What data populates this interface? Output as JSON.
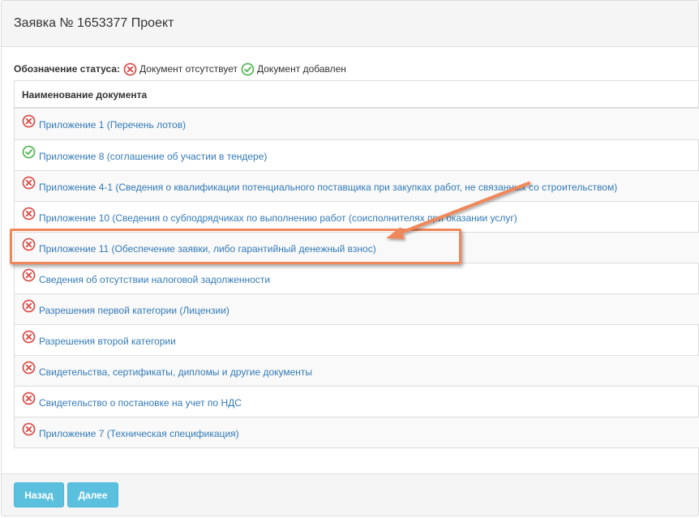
{
  "header": {
    "title": "Заявка № 1653377 Проект"
  },
  "legend": {
    "label": "Обозначение статуса:",
    "missing_text": "Документ отсутствует",
    "added_text": "Документ добавлен"
  },
  "table": {
    "header": "Наименование документа",
    "rows": [
      {
        "label": "Приложение 1 (Перечень лотов)",
        "status": "missing"
      },
      {
        "label": "Приложение 8 (соглашение об участии в тендере)",
        "status": "added"
      },
      {
        "label": "Приложение 4-1 (Сведения о квалификации потенциального поставщика при закупках работ, не связанных со строительством)",
        "status": "missing"
      },
      {
        "label": "Приложение 10 (Сведения о субподрядчиках по выполнению работ (соисполнителях при оказании услуг)",
        "status": "missing"
      },
      {
        "label": "Приложение 11 (Обеспечение заявки, либо гарантийный денежный взнос)",
        "status": "missing"
      },
      {
        "label": "Сведения об отсутствии налоговой задолженности",
        "status": "missing"
      },
      {
        "label": "Разрешения первой категории (Лицензии)",
        "status": "missing"
      },
      {
        "label": "Разрешения второй категории",
        "status": "missing"
      },
      {
        "label": "Свидетельства, сертификаты, дипломы и другие документы",
        "status": "missing"
      },
      {
        "label": "Свидетельство о постановке на учет по НДС",
        "status": "missing"
      },
      {
        "label": "Приложение 7 (Техническая спецификация)",
        "status": "missing"
      }
    ]
  },
  "footer": {
    "back_label": "Назад",
    "next_label": "Далее"
  },
  "colors": {
    "missing": "#d9534f",
    "added": "#5cb85c",
    "link": "#337ab7",
    "button": "#5bc0de",
    "annotation": "#f0875a"
  },
  "icons": {
    "missing": "x-circle-icon",
    "added": "check-circle-icon"
  }
}
